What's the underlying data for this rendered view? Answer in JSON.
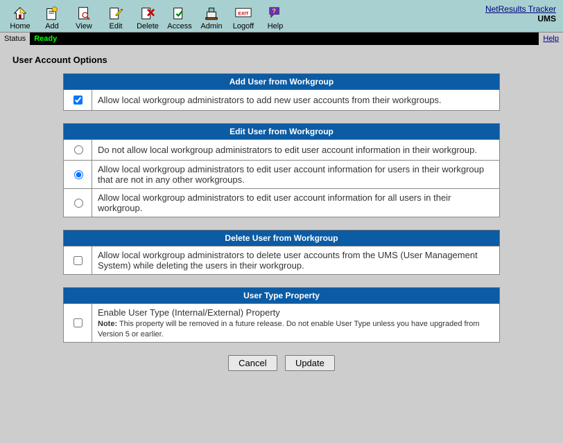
{
  "app": {
    "name": "NetResults Tracker",
    "module": "UMS"
  },
  "toolbar": {
    "home": "Home",
    "add": "Add",
    "view": "View",
    "edit": "Edit",
    "delete": "Delete",
    "access": "Access",
    "admin": "Admin",
    "logoff": "Logoff",
    "help": "Help"
  },
  "status": {
    "label": "Status",
    "value": "Ready",
    "help": "Help"
  },
  "page_title": "User Account Options",
  "sections": {
    "add": {
      "header": "Add User from Workgroup",
      "opt1": {
        "label": "Allow local workgroup administrators to add new user accounts from their workgroups.",
        "checked": true
      }
    },
    "edit": {
      "header": "Edit User from Workgroup",
      "opt1": "Do not allow local workgroup administrators to edit user account information in their workgroup.",
      "opt2": "Allow local workgroup administrators to edit user account information for users in their workgroup that are not in any other workgroups.",
      "opt3": "Allow local workgroup administrators to edit user account information for all users in their workgroup.",
      "selected": 2
    },
    "delete": {
      "header": "Delete User from Workgroup",
      "opt1": {
        "label": "Allow local workgroup administrators to delete user accounts from the UMS (User Management System) while deleting the users in their workgroup.",
        "checked": false
      }
    },
    "usertype": {
      "header": "User Type Property",
      "opt1": {
        "label": "Enable User Type (Internal/External) Property",
        "checked": false
      },
      "note_label": "Note:",
      "note_text": " This property will be removed in a future release. Do not enable User Type unless you have upgraded from Version 5 or earlier."
    }
  },
  "buttons": {
    "cancel": "Cancel",
    "update": "Update"
  }
}
